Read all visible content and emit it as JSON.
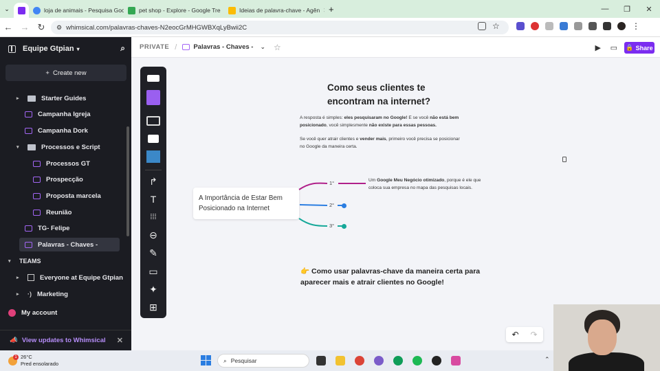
{
  "browser": {
    "tabs": [
      {
        "title": "",
        "color": "#7b2cf0",
        "active": true
      },
      {
        "title": "loja de animais - Pesquisa Goog",
        "color": "#4285f4"
      },
      {
        "title": "pet shop - Explore - Google Tre",
        "color": "#34a853"
      },
      {
        "title": "Ideias de palavra-chave - Agên",
        "color": "#fbbc05"
      }
    ],
    "new_tab": "+",
    "url": "whimsical.com/palavras-chaves-N2eocGrMHGWBXqLyBwii2C"
  },
  "sidebar": {
    "workspace": "Equipe Gtpian",
    "create_label": "Create new",
    "items": [
      {
        "label": "Starter Guides",
        "type": "folder",
        "arrow": "▸"
      },
      {
        "label": "Campanha Igreja",
        "type": "board"
      },
      {
        "label": "Campanha Dork",
        "type": "board"
      },
      {
        "label": "Processos e Script",
        "type": "folder",
        "arrow": "▾"
      },
      {
        "label": "Processos GT",
        "type": "board"
      },
      {
        "label": "Prospecção",
        "type": "board"
      },
      {
        "label": "Proposta marcela",
        "type": "board"
      },
      {
        "label": "Reunião",
        "type": "board"
      },
      {
        "label": "TG- Felipe",
        "type": "board"
      },
      {
        "label": "Palavras - Chaves -",
        "type": "board",
        "selected": true
      }
    ],
    "teams_label": "TEAMS",
    "teams": [
      {
        "label": "Everyone at Equipe Gtpian"
      },
      {
        "label": "Marketing"
      }
    ],
    "my_account": "My account",
    "updates": "View updates to Whimsical"
  },
  "topbar": {
    "private_label": "PRIVATE",
    "separator": "/",
    "doc_title": "Palavras - Chaves -",
    "share_label": "Share"
  },
  "board": {
    "heading_line1": "Como seus clientes te",
    "heading_line2": "encontram na internet?",
    "para1": {
      "t1": "A resposta é simples: ",
      "b1": "eles pesquisaram no Google!",
      "t2": " E se você ",
      "b2": "não está bem posicionado",
      "t3": ", você simplesmente ",
      "b3": "não existe para essas pessoas.",
      "t4": ""
    },
    "para2": {
      "t1": "Se você quer atrair clientes e ",
      "b1": "vender mais",
      "t2": ", primeiro você precisa se posicionar no Google da maneira certa."
    },
    "central_topic": "A Importância de Estar Bem Posicionado na Internet",
    "branches": [
      "1°",
      "2°",
      "3°"
    ],
    "branch_colors": [
      "#b0208a",
      "#2a7de1",
      "#16a899"
    ],
    "note": {
      "t1": "Um ",
      "b1": "Google Meu Negócio otimizado",
      "t2": ", porque é ele que coloca sua empresa no mapa das pesquisas locais."
    },
    "cta_emoji": "👉",
    "cta_text": "Como usar palavras-chave da maneira certa para aparecer mais e atrair clientes no Google!"
  },
  "taskbar": {
    "temp": "26°C",
    "weather": "Pred ensolarado",
    "weather_badge": "1",
    "search_placeholder": "Pesquisar"
  }
}
